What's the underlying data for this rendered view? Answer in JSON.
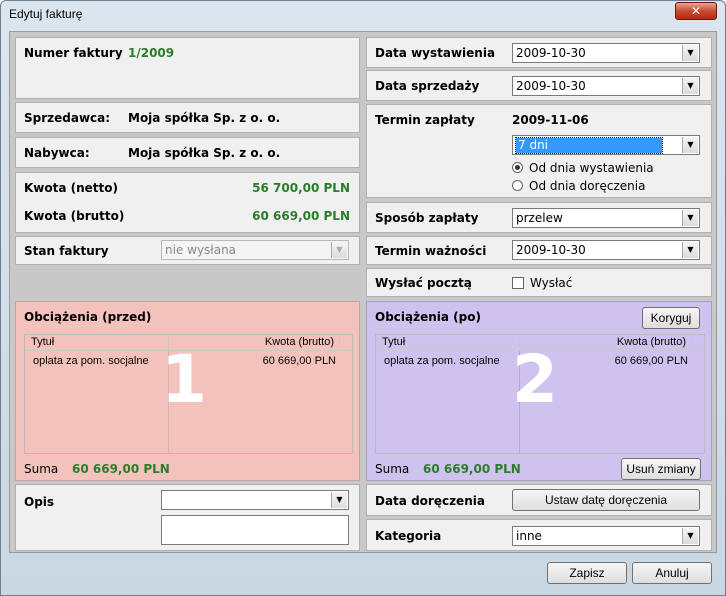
{
  "window": {
    "title": "Edytuj fakturę",
    "close_glyph": "✕"
  },
  "invoice_number": {
    "label": "Numer faktury",
    "value": "1/2009"
  },
  "seller": {
    "label": "Sprzedawca:",
    "value": "Moja spółka Sp. z o. o."
  },
  "buyer": {
    "label": "Nabywca:",
    "value": "Moja spółka Sp. z o. o."
  },
  "amount_net": {
    "label": "Kwota (netto)",
    "value": "56 700,00 PLN"
  },
  "amount_gross": {
    "label": "Kwota (brutto)",
    "value": "60 669,00 PLN"
  },
  "invoice_status": {
    "label": "Stan faktury",
    "value": "nie wysłana"
  },
  "issue_date": {
    "label": "Data wystawienia",
    "value": "2009-10-30"
  },
  "sale_date": {
    "label": "Data sprzedaży",
    "value": "2009-10-30"
  },
  "payment_term": {
    "label": "Termin zapłaty",
    "date": "2009-11-06",
    "days": "7 dni",
    "radio_issue": "Od dnia wystawienia",
    "radio_delivery": "Od dnia doręczenia"
  },
  "payment_method": {
    "label": "Sposób zapłaty",
    "value": "przelew"
  },
  "validity_term": {
    "label": "Termin ważności",
    "value": "2009-10-30"
  },
  "send_post": {
    "label": "Wysłać pocztą",
    "checkbox_label": "Wysłać"
  },
  "charges_before": {
    "title": "Obciążenia (przed)",
    "col_title": "Tytuł",
    "col_amount": "Kwota (brutto)",
    "rows": [
      {
        "title": "oplata za pom. socjalne",
        "amount": "60 669,00 PLN"
      }
    ],
    "sum_label": "Suma",
    "sum_value": "60 669,00 PLN",
    "big_number": "1"
  },
  "charges_after": {
    "title": "Obciążenia (po)",
    "correct_button": "Koryguj",
    "col_title": "Tytuł",
    "col_amount": "Kwota (brutto)",
    "rows": [
      {
        "title": "oplata za pom. socjalne",
        "amount": "60 669,00 PLN"
      }
    ],
    "sum_label": "Suma",
    "sum_value": "60 669,00 PLN",
    "remove_button": "Usuń zmiany",
    "big_number": "2"
  },
  "description": {
    "label": "Opis",
    "value": ""
  },
  "delivery_date": {
    "label": "Data doręczenia",
    "button": "Ustaw datę doręczenia"
  },
  "category": {
    "label": "Kategoria",
    "value": "inne"
  },
  "footer": {
    "save": "Zapisz",
    "cancel": "Anuluj"
  },
  "colors": {
    "green": "#2a7d2a",
    "red_panel": "#f4c2bd",
    "blue_panel": "#cfc2ef"
  },
  "icons": {
    "dropdown": "chevron-down-icon"
  }
}
